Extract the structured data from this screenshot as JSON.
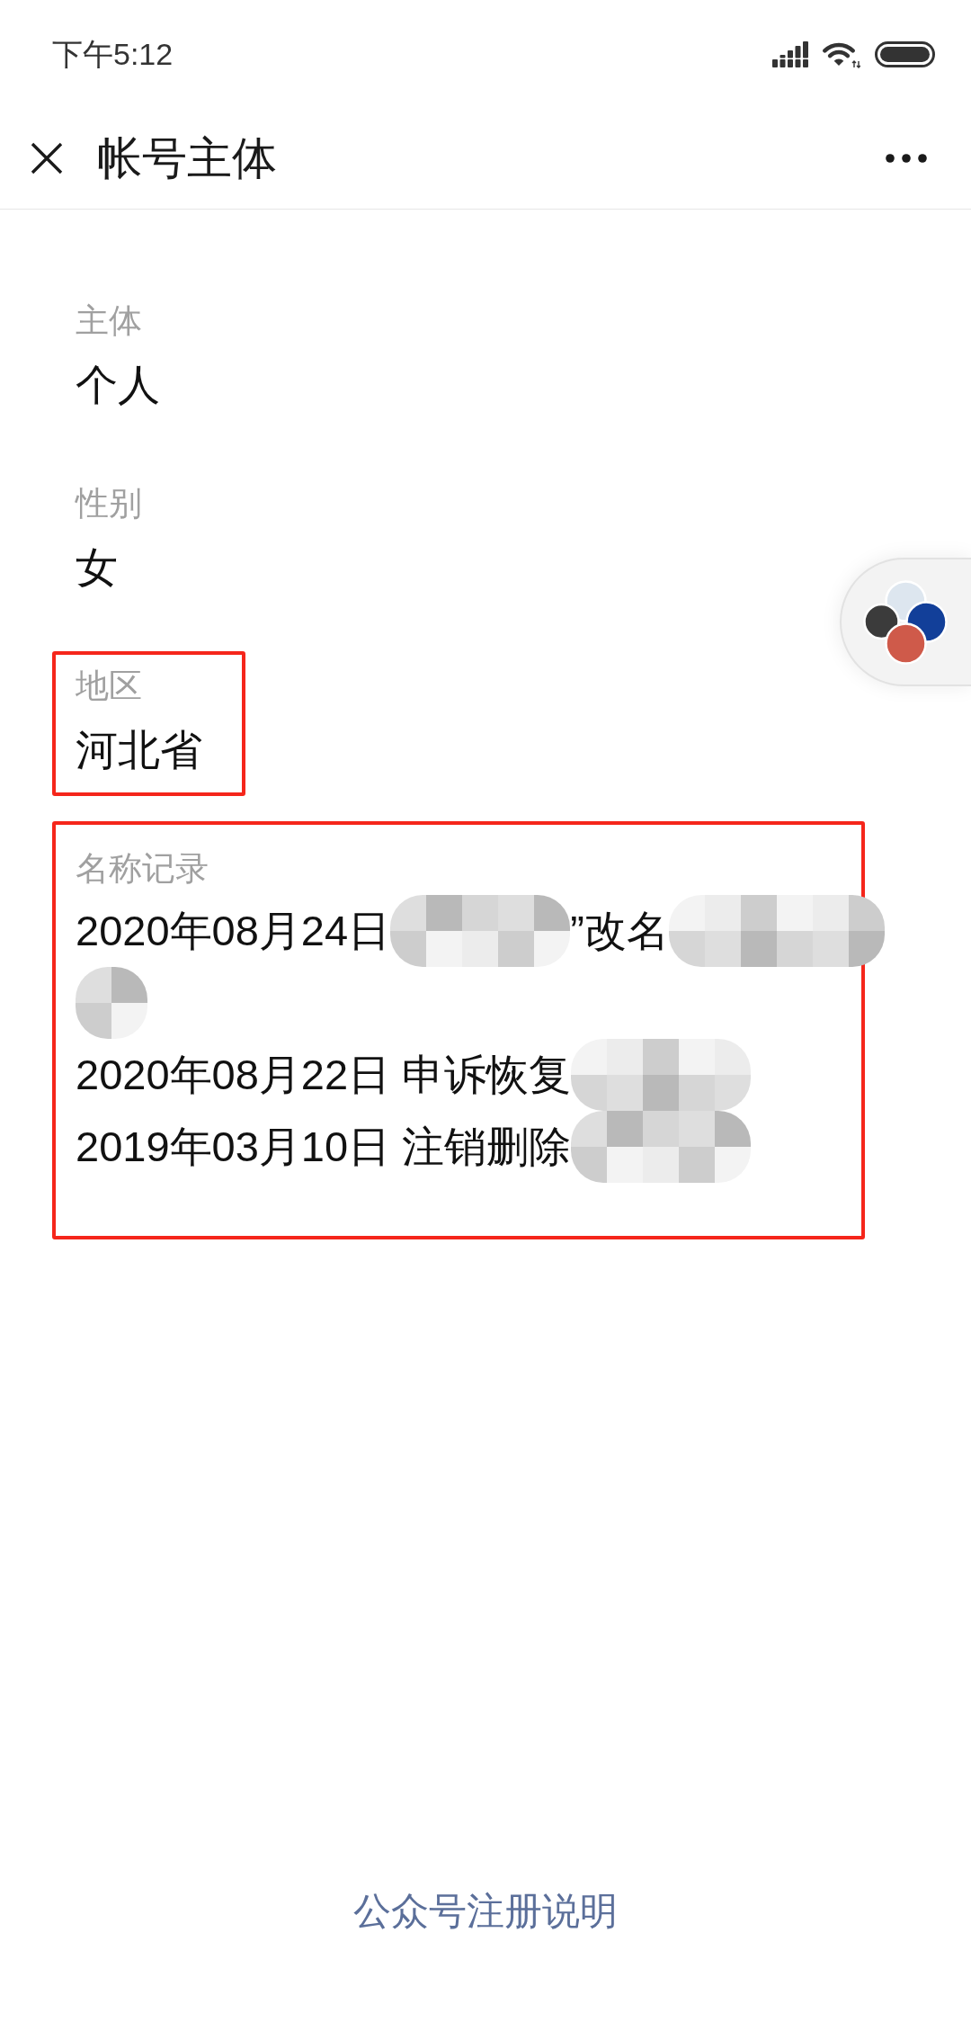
{
  "status_bar": {
    "time": "下午5:12"
  },
  "header": {
    "title": "帐号主体"
  },
  "fields": [
    {
      "kind": "text",
      "label": "主体",
      "value": "个人",
      "highlighted": false
    },
    {
      "kind": "text",
      "label": "性别",
      "value": "女",
      "highlighted": false
    },
    {
      "kind": "text",
      "label": "地区",
      "value": "河北省",
      "highlighted": true
    },
    {
      "kind": "records",
      "label": "名称记录",
      "highlighted": true,
      "records": [
        {
          "segments": [
            {
              "kind": "text",
              "text": "2020年08月24日"
            },
            {
              "kind": "redacted"
            },
            {
              "kind": "text",
              "text": "”改名"
            },
            {
              "kind": "redacted"
            },
            {
              "kind": "redacted"
            }
          ]
        },
        {
          "segments": [
            {
              "kind": "text",
              "text": "2020年08月22日 申诉恢复"
            },
            {
              "kind": "redacted"
            }
          ]
        },
        {
          "segments": [
            {
              "kind": "text",
              "text": "2019年03月10日 注销删除"
            },
            {
              "kind": "redacted"
            }
          ]
        }
      ]
    }
  ],
  "footer": {
    "link": "公众号注册说明"
  }
}
